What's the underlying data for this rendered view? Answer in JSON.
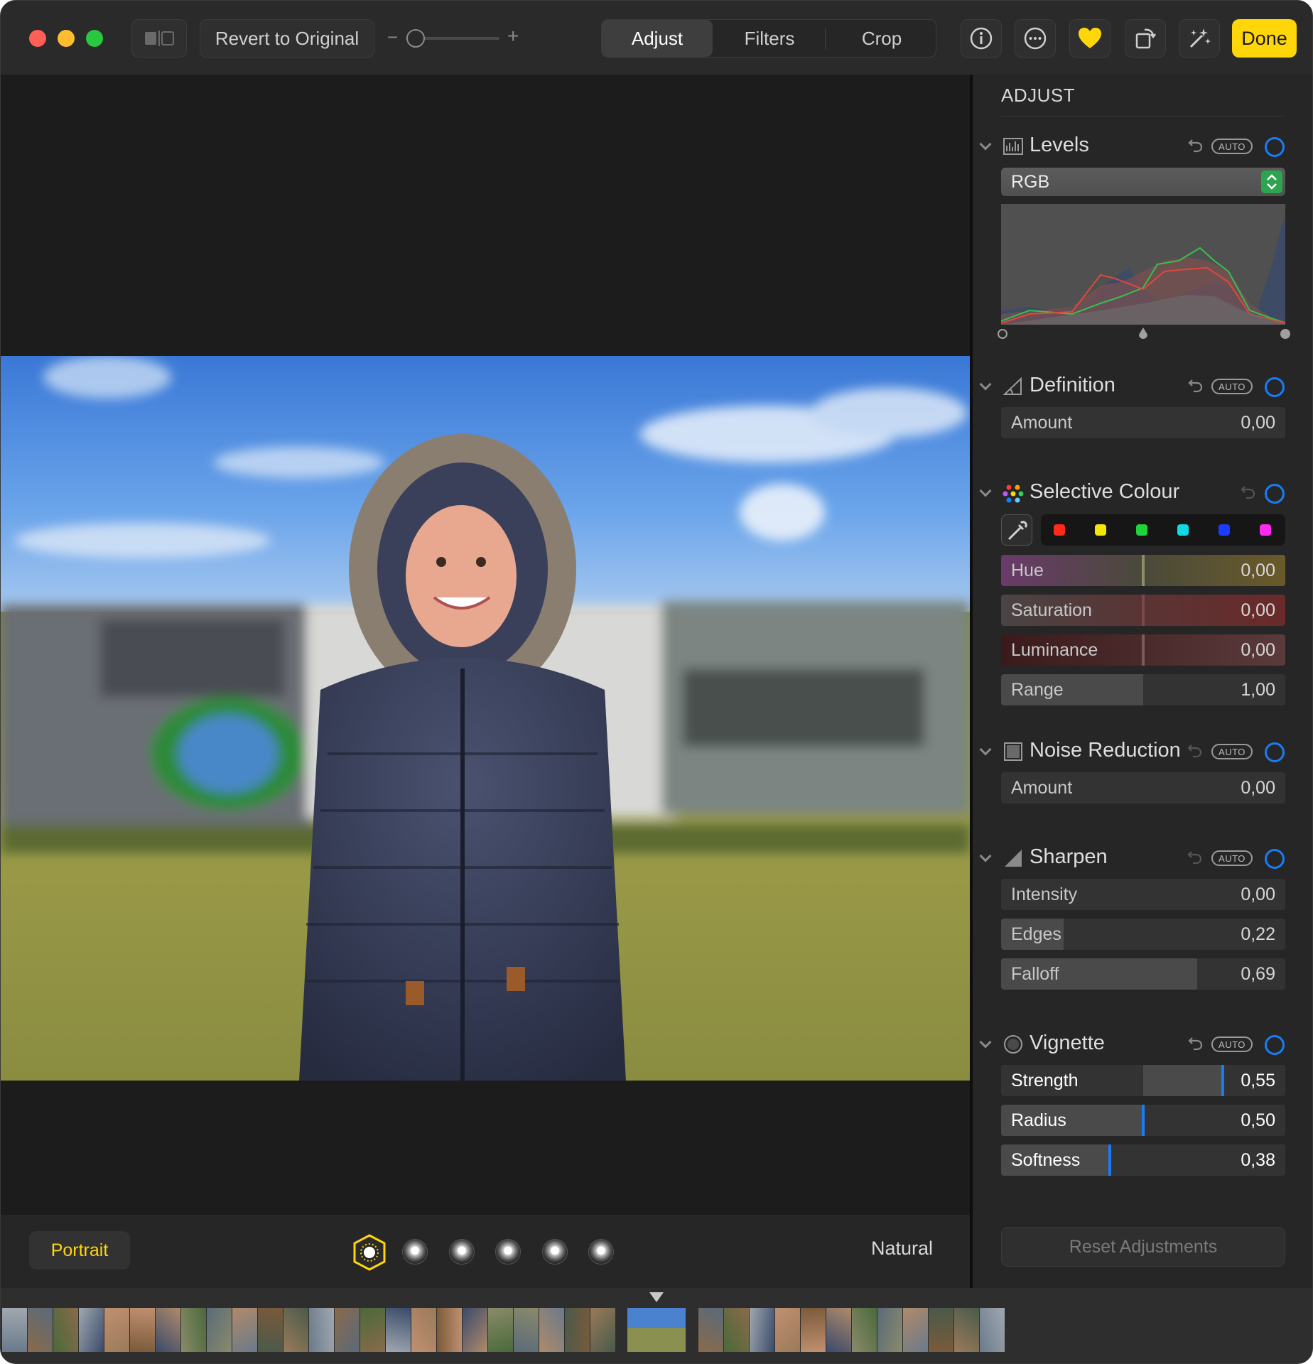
{
  "toolbar": {
    "revert_label": "Revert to Original",
    "zoom_minus": "−",
    "zoom_plus": "+",
    "tabs": [
      {
        "label": "Adjust",
        "active": true
      },
      {
        "label": "Filters",
        "active": false
      },
      {
        "label": "Crop",
        "active": false
      }
    ],
    "icons": [
      "split-view-icon",
      "info-icon",
      "more-icon",
      "heart-icon",
      "rotate-icon",
      "magic-wand-icon"
    ],
    "done_label": "Done",
    "accent_color": "#ffd60a"
  },
  "portrait_bar": {
    "portrait_label": "Portrait",
    "lighting_effects": [
      "cube-icon",
      "light-1",
      "light-2",
      "light-3",
      "light-4",
      "light-5"
    ],
    "lighting_name": "Natural"
  },
  "panel": {
    "title": "ADJUST",
    "auto_label": "AUTO",
    "toggle_color": "#1a7cf5",
    "levels": {
      "name": "Levels",
      "channel": "RGB"
    },
    "definition": {
      "name": "Definition",
      "rows": [
        {
          "label": "Amount",
          "value": "0,00"
        }
      ]
    },
    "selective_colour": {
      "name": "Selective Colour",
      "swatches": [
        "#ff2a1a",
        "#f5e60a",
        "#1ed43a",
        "#12d8e6",
        "#1a3cff",
        "#ff2af0"
      ],
      "rows": [
        {
          "label": "Hue",
          "value": "0,00"
        },
        {
          "label": "Saturation",
          "value": "0,00"
        },
        {
          "label": "Luminance",
          "value": "0,00"
        },
        {
          "label": "Range",
          "value": "1,00"
        }
      ]
    },
    "noise_reduction": {
      "name": "Noise Reduction",
      "rows": [
        {
          "label": "Amount",
          "value": "0,00"
        }
      ]
    },
    "sharpen": {
      "name": "Sharpen",
      "rows": [
        {
          "label": "Intensity",
          "value": "0,00"
        },
        {
          "label": "Edges",
          "value": "0,22"
        },
        {
          "label": "Falloff",
          "value": "0,69"
        }
      ]
    },
    "vignette": {
      "name": "Vignette",
      "rows": [
        {
          "label": "Strength",
          "value": "0,55"
        },
        {
          "label": "Radius",
          "value": "0,50"
        },
        {
          "label": "Softness",
          "value": "0,38"
        }
      ]
    },
    "reset_label": "Reset Adjustments"
  }
}
